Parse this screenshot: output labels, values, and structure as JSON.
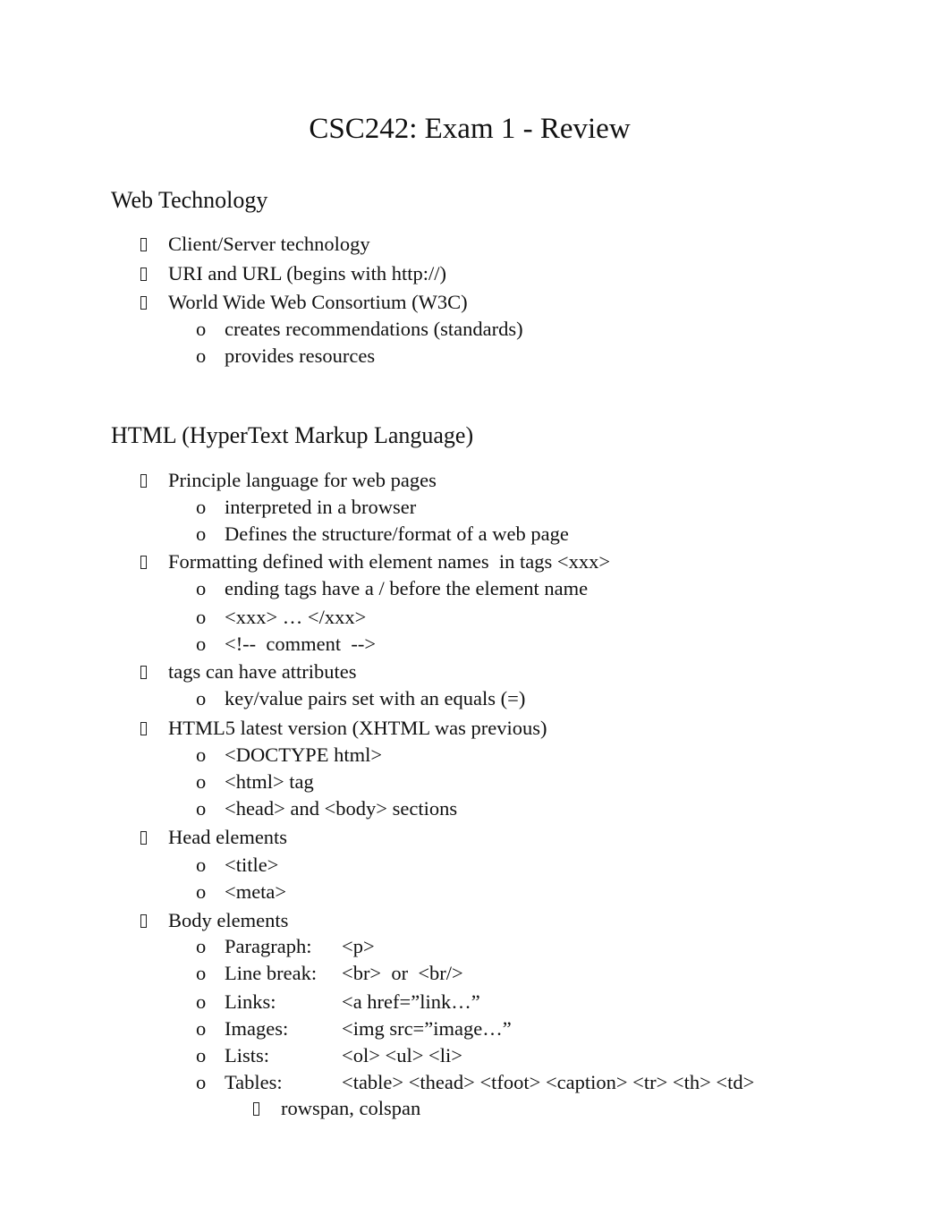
{
  "title": "CSC242: Exam 1 - Review",
  "sections": [
    {
      "heading": "Web Technology",
      "items": [
        {
          "text": "Client/Server technology",
          "sub": []
        },
        {
          "text": "URI and URL (begins with http://)",
          "sub": []
        },
        {
          "text": "World Wide Web Consortium (W3C)",
          "sub": [
            {
              "text": "creates recommendations (standards)"
            },
            {
              "text": "provides resources"
            }
          ]
        }
      ]
    },
    {
      "heading": "HTML (HyperText Markup Language)",
      "items": [
        {
          "text": "Principle language for web pages",
          "sub": [
            {
              "text": "interpreted in a browser"
            },
            {
              "text": "Defines the structure/format of a web page"
            }
          ]
        },
        {
          "text": "Formatting defined with element names  in tags <xxx>",
          "sub": [
            {
              "text": "ending tags have a / before the element name"
            },
            {
              "text": "<xxx> … </xxx>"
            },
            {
              "text": "<!--  comment  -->"
            }
          ]
        },
        {
          "text": "tags can have attributes",
          "sub": [
            {
              "text": "key/value pairs set with an equals (=)"
            }
          ]
        },
        {
          "text": "HTML5 latest version (XHTML was previous)",
          "sub": [
            {
              "text": "<DOCTYPE html>"
            },
            {
              "text": "<html> tag"
            },
            {
              "text": "<head> and <body> sections"
            }
          ]
        },
        {
          "text": "Head elements",
          "sub": [
            {
              "text": "<title>"
            },
            {
              "text": "<meta>"
            }
          ]
        },
        {
          "text": "Body elements",
          "sub": [
            {
              "label": "Paragraph:",
              "text": "<p>"
            },
            {
              "label": "Line break:",
              "text": "<br>  or  <br/>"
            },
            {
              "label": "Links:",
              "text": "<a href=”link…”"
            },
            {
              "label": "Images:",
              "text": "<img src=”image…”"
            },
            {
              "label": "Lists:",
              "text": "<ol> <ul> <li>"
            },
            {
              "label": "Tables:",
              "text": "<table> <thead> <tfoot> <caption> <tr> <th> <td>",
              "sub": [
                {
                  "text": "rowspan, colspan"
                }
              ]
            }
          ]
        }
      ]
    }
  ],
  "markers": {
    "level1": "missing-glyph-box",
    "level2": "o",
    "level3": "missing-glyph-box"
  }
}
